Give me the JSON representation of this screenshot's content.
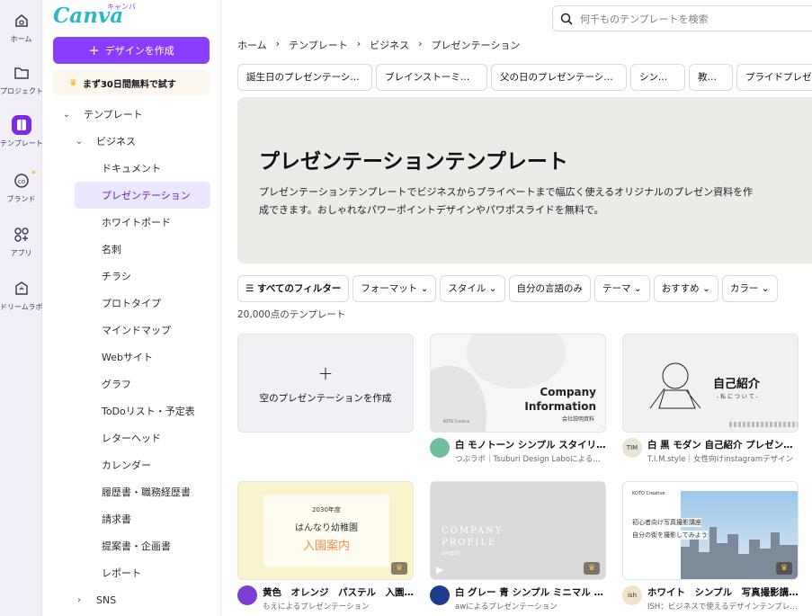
{
  "rail": [
    {
      "label": "ホーム",
      "icon": "home-icon"
    },
    {
      "label": "プロジェクト",
      "icon": "folder-icon"
    },
    {
      "label": "テンプレート",
      "icon": "template-icon"
    },
    {
      "label": "ブランド",
      "icon": "brand-icon"
    },
    {
      "label": "アプリ",
      "icon": "apps-icon"
    },
    {
      "label": "ドリームラボ",
      "icon": "dream-lab-icon"
    }
  ],
  "sidebar": {
    "logo": "Canva",
    "logo_kana": "キャンバ",
    "create_button": "デザインを作成",
    "trial_button": "まず30日間無料で試す",
    "tree": [
      {
        "label": "テンプレート",
        "level": 0,
        "expanded": true
      },
      {
        "label": "ビジネス",
        "level": 1,
        "expanded": true
      },
      {
        "label": "ドキュメント",
        "level": 2
      },
      {
        "label": "プレゼンテーション",
        "level": 2,
        "selected": true
      },
      {
        "label": "ホワイトボード",
        "level": 2
      },
      {
        "label": "名刺",
        "level": 2
      },
      {
        "label": "チラシ",
        "level": 2
      },
      {
        "label": "プロトタイプ",
        "level": 2
      },
      {
        "label": "マインドマップ",
        "level": 2
      },
      {
        "label": "Webサイト",
        "level": 2
      },
      {
        "label": "グラフ",
        "level": 2
      },
      {
        "label": "ToDoリスト・予定表",
        "level": 2
      },
      {
        "label": "レターヘッド",
        "level": 2
      },
      {
        "label": "カレンダー",
        "level": 2
      },
      {
        "label": "履歴書・職務経歴書",
        "level": 2
      },
      {
        "label": "請求書",
        "level": 2
      },
      {
        "label": "提案書・企画書",
        "level": 2
      },
      {
        "label": "レポート",
        "level": 2
      },
      {
        "label": "SNS",
        "level": 1,
        "expanded": false
      }
    ]
  },
  "search": {
    "placeholder": "何千ものテンプレートを検索"
  },
  "breadcrumb": [
    "ホーム",
    "テンプレート",
    "ビジネス",
    "プレゼンテーション"
  ],
  "chips": [
    "誕生日のプレゼンテーション",
    "ブレインストーミング",
    "父の日のプレゼンテーション",
    "シンプル",
    "教育版",
    "プライドプレゼンテーション"
  ],
  "hero": {
    "title": "プレゼンテーションテンプレート",
    "description": "プレゼンテーションテンプレートでビジネスからプライベートまで幅広く使えるオリジナルのプレゼン資料を作成できます。おしゃれなパワーポイントデザインやパワポスライドを無料で。"
  },
  "filters": {
    "all": "すべてのフィルター",
    "items": [
      "フォーマット",
      "スタイル",
      "自分の言語のみ",
      "テーマ",
      "おすすめ",
      "カラー"
    ]
  },
  "count": "20,000点のテンプレート",
  "blank_card": {
    "label": "空のプレゼンテーションを作成"
  },
  "cards": [
    {
      "title": "白 モノトーン シンプル スタイリッシュ 会社説明資料 プレゼンテーション",
      "author": "つぶラボ｜Tsuburi Design Laboによるプレゼンテーション",
      "thumb_title": "Company Information",
      "thumb_sub": "会社説明資料",
      "thumb_brand": "KOTO Creative",
      "avatar_color": "#6fbf9f"
    },
    {
      "title": "白 黒 モダン 自己紹介 プレゼンテーション",
      "author": "T.I.M.style｜女性向けinstagramデザイン",
      "thumb_title": "自己紹介",
      "thumb_sub": "- 私 に つ い て -",
      "avatar_text": "TIM",
      "avatar_color": "#e9e4d8"
    },
    {
      "title": "黄色　オレンジ　パステル　入園案内 プレゼンテーション",
      "author": "もえによるプレゼンテーション",
      "thumb_year": "2030年度",
      "thumb_name": "はんなり幼稚園",
      "thumb_title": "入園案内",
      "avatar_color": "#7b3fd6"
    },
    {
      "title": "白 グレー 青 シンプル ミニマル 会社紹介 プレゼンテーション",
      "author": "awによるプレゼンテーション",
      "thumb_title": "COMPANY PROFILE",
      "thumb_sub": "会社案内",
      "avatar_color": "#1f3b8c"
    },
    {
      "title": "ホワイト　シンプル　写真撮影講座 プレゼンテーション",
      "author": "ISH：ビジネスで使えるデザインテンプレート",
      "thumb_brand": "KOTO Creative",
      "thumb_title": "初心者向け写真撮影講座",
      "thumb_sub": "自分の街を撮影してみよう",
      "avatar_text": "ish",
      "avatar_color": "#f0e3c8"
    }
  ]
}
